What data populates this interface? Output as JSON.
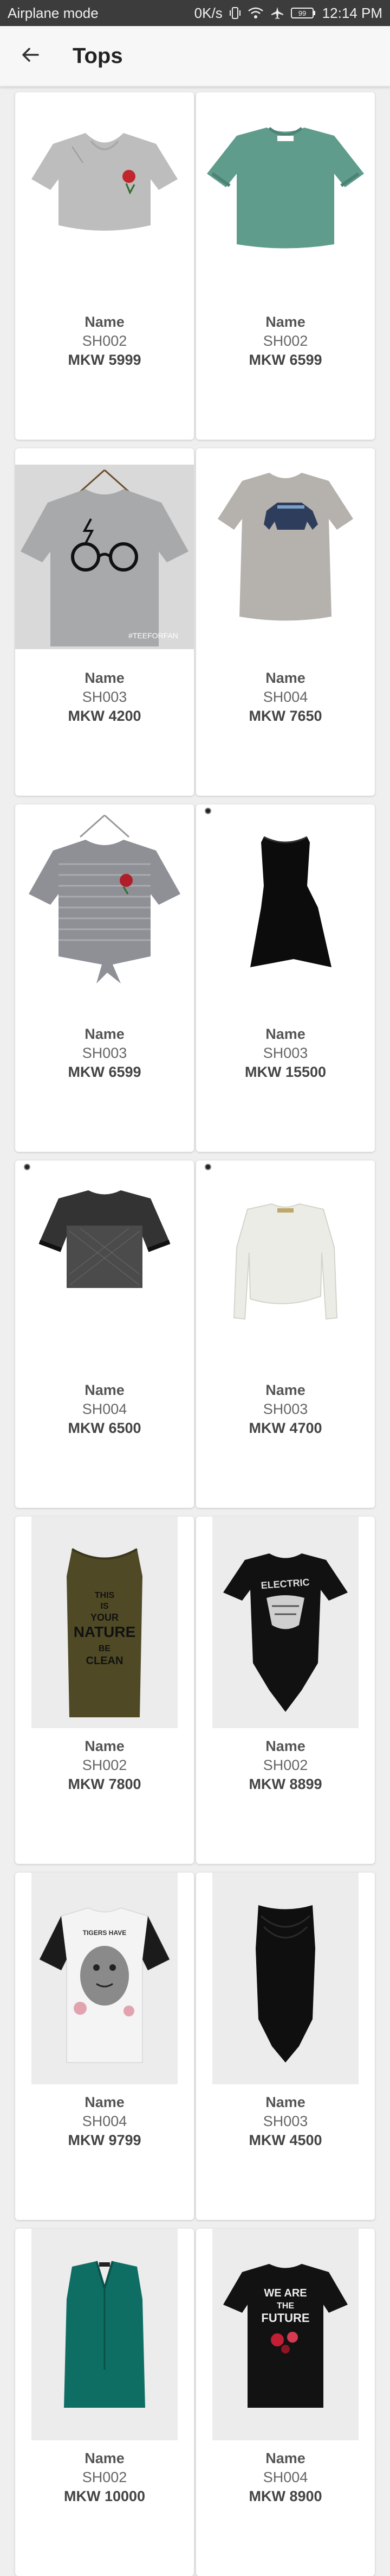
{
  "status_bar": {
    "left_text": "Airplane mode",
    "speed": "0K/s",
    "battery": "99",
    "time": "12:14 PM",
    "icons": [
      "vibrate-icon",
      "wifi-icon",
      "airplane-icon",
      "battery-icon"
    ]
  },
  "app_bar": {
    "title": "Tops",
    "back_icon": "arrow-left-icon"
  },
  "products": [
    {
      "name": "Name",
      "code": "SH002",
      "price": "MKW 5999",
      "image": "grey-crop-top-rose"
    },
    {
      "name": "Name",
      "code": "SH002",
      "price": "MKW 6599",
      "image": "green-tshirt"
    },
    {
      "name": "Name",
      "code": "SH003",
      "price": "MKW 4200",
      "image": "grey-tshirt-glasses"
    },
    {
      "name": "Name",
      "code": "SH004",
      "price": "MKW 7650",
      "image": "grey-tshirt-bear"
    },
    {
      "name": "Name",
      "code": "SH003",
      "price": "MKW 6599",
      "image": "striped-tie-front-top"
    },
    {
      "name": "Name",
      "code": "SH003",
      "price": "MKW 15500",
      "image": "black-asymmetric-top"
    },
    {
      "name": "Name",
      "code": "SH004",
      "price": "MKW 6500",
      "image": "black-mesh-top"
    },
    {
      "name": "Name",
      "code": "SH003",
      "price": "MKW 4700",
      "image": "white-long-sleeve-top"
    },
    {
      "name": "Name",
      "code": "SH002",
      "price": "MKW 7800",
      "image": "khaki-slogan-tank"
    },
    {
      "name": "Name",
      "code": "SH002",
      "price": "MKW 8899",
      "image": "black-electric-bodysuit"
    },
    {
      "name": "Name",
      "code": "SH004",
      "price": "MKW 9799",
      "image": "white-tiger-lace-tee"
    },
    {
      "name": "Name",
      "code": "SH003",
      "price": "MKW 4500",
      "image": "black-cowl-bodysuit"
    },
    {
      "name": "Name",
      "code": "SH002",
      "price": "MKW 10000",
      "image": "teal-sleeveless-blouse"
    },
    {
      "name": "Name",
      "code": "SH004",
      "price": "MKW 8900",
      "image": "black-future-tee"
    }
  ],
  "print_texts": {
    "brand_tag": "#TEEFORFAN",
    "khaki_tank": [
      "THIS",
      "IS",
      "YOUR",
      "NATURE",
      "BE",
      "CLEAN"
    ],
    "electric": "ELECTRIC",
    "tiger_tee": "TIGERS HAVE",
    "future_tee": [
      "WE ARE",
      "THE",
      "FUTURE"
    ]
  },
  "colors": {
    "status_bg": "#3c3c3c",
    "app_bar_bg": "#f7f7f7",
    "page_bg": "#efefef",
    "card_bg": "#ffffff"
  }
}
